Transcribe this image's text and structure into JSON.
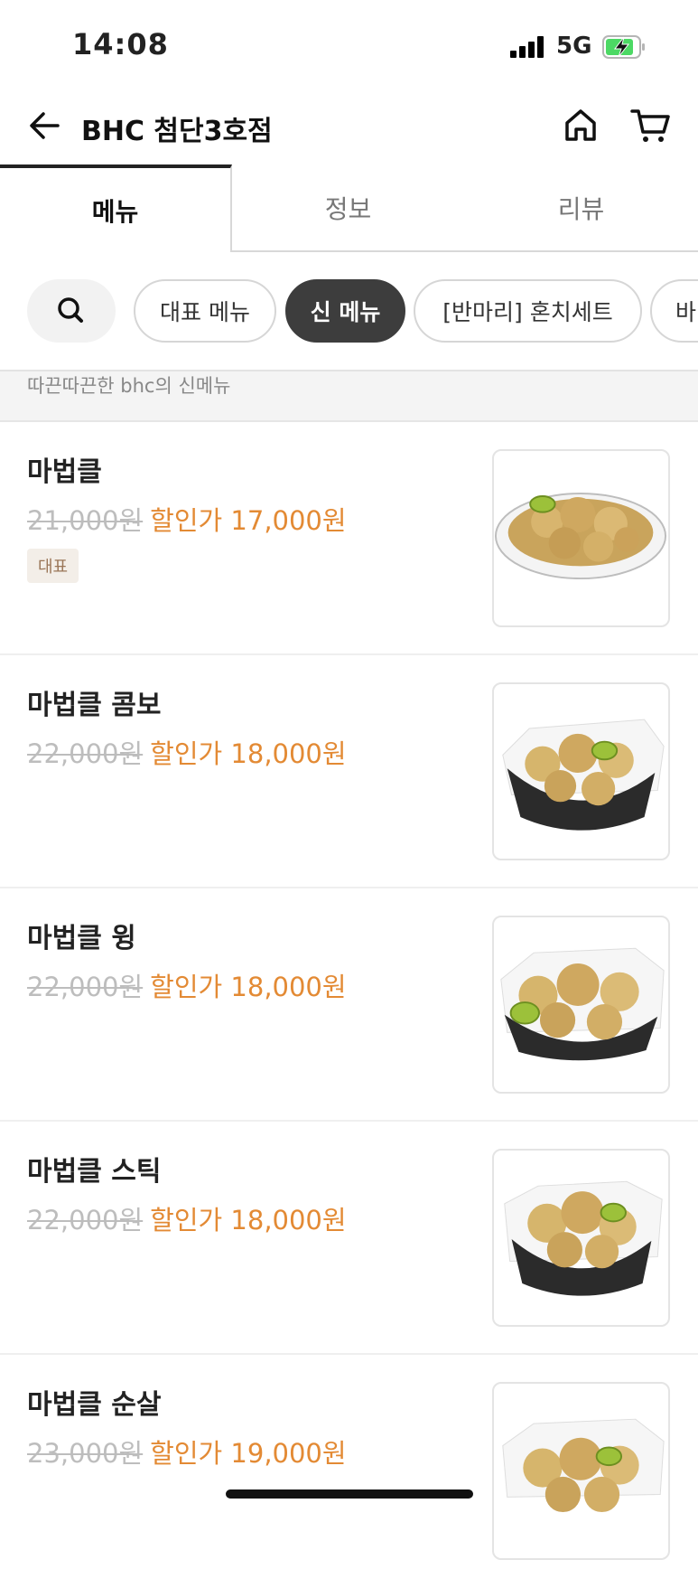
{
  "status": {
    "time": "14:08",
    "network": "5G"
  },
  "header": {
    "title": "BHC 첨단3호점"
  },
  "tabs": [
    "메뉴",
    "정보",
    "리뷰"
  ],
  "filters": [
    "대표 메뉴",
    "신 메뉴",
    "[반마리] 혼치세트",
    "바"
  ],
  "active_filter": "신 메뉴",
  "section_description": "따끈따끈한 bhc의 신메뉴",
  "menu_items": [
    {
      "name": "마법클",
      "original_price": "21,000원",
      "sale_price": "할인가 17,000원",
      "tag": "대표"
    },
    {
      "name": "마법클 콤보",
      "original_price": "22,000원",
      "sale_price": "할인가 18,000원"
    },
    {
      "name": "마법클 윙",
      "original_price": "22,000원",
      "sale_price": "할인가 18,000원"
    },
    {
      "name": "마법클 스틱",
      "original_price": "22,000원",
      "sale_price": "할인가 18,000원"
    },
    {
      "name": "마법클 순살",
      "original_price": "23,000원",
      "sale_price": "할인가 19,000원"
    }
  ],
  "colors": {
    "sale": "#e38a34",
    "active_chip": "#3d3d3d",
    "tag_bg": "#f3eee8"
  }
}
